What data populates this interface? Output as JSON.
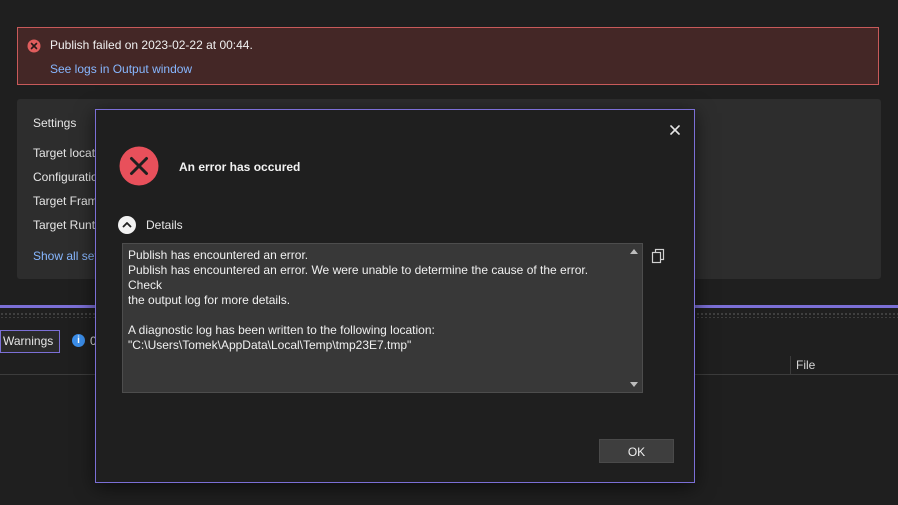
{
  "banner": {
    "message": "Publish failed on 2023-02-22 at 00:44.",
    "link": "See logs in Output window",
    "icon": "error-circle-icon",
    "color": "#e05d5d"
  },
  "settings": {
    "title": "Settings",
    "rows": [
      "Target locat",
      "Configuratio",
      "Target Fram",
      "Target Runti"
    ],
    "link": "Show all set"
  },
  "error_list": {
    "warnings_label": "Warnings",
    "info_count": "0",
    "column_file": "File"
  },
  "dialog": {
    "heading": "An error has occured",
    "details_label": "Details",
    "details_lines": [
      "Publish has encountered an error.",
      "Publish has encountered an error. We were unable to determine the cause of the error. Check",
      "the output log for more details.",
      "",
      "A diagnostic log has been written to the following location:",
      "\"C:\\Users\\Tomek\\AppData\\Local\\Temp\\tmp23E7.tmp\""
    ],
    "ok_label": "OK",
    "error_icon_color": "#e8505b",
    "accent_border": "#7b6fd6"
  }
}
